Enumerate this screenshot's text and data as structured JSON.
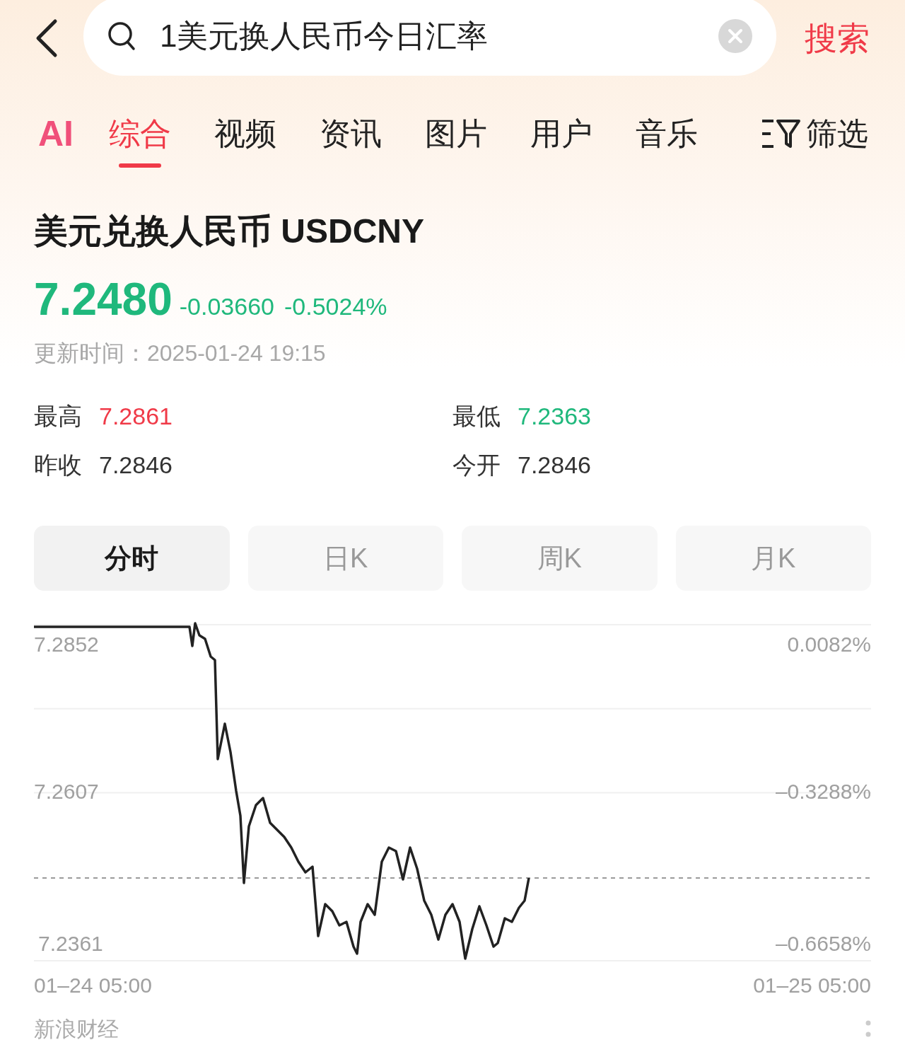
{
  "search_bar": {
    "value": "1美元换人民币今日汇率",
    "submit": "搜索"
  },
  "tabs": [
    {
      "label": "AI",
      "kind": "logo",
      "selected": false
    },
    {
      "label": "综合",
      "kind": "text",
      "selected": true
    },
    {
      "label": "视频",
      "kind": "text",
      "selected": false
    },
    {
      "label": "资讯",
      "kind": "text",
      "selected": false
    },
    {
      "label": "图片",
      "kind": "text",
      "selected": false
    },
    {
      "label": "用户",
      "kind": "text",
      "selected": false
    },
    {
      "label": "音乐",
      "kind": "text",
      "selected": false
    }
  ],
  "filter": "筛选",
  "quote": {
    "title": "美元兑换人民币 USDCNY",
    "price": "7.2480",
    "change": "-0.03660",
    "change_percent": "-0.5024%",
    "color": "#1fb87c",
    "updated": "更新时间：2025-01-24 19:15"
  },
  "stats": [
    {
      "label": "最高",
      "value": "7.2861",
      "color": "#f03a48"
    },
    {
      "label": "最低",
      "value": "7.2363",
      "color": "#1fb87c"
    },
    {
      "label": "昨收",
      "value": "7.2846",
      "color": "#333333"
    },
    {
      "label": "今开",
      "value": "7.2846",
      "color": "#333333"
    }
  ],
  "periods": [
    {
      "label": "分时",
      "selected": true
    },
    {
      "label": "日K",
      "selected": false
    },
    {
      "label": "周K",
      "selected": false
    },
    {
      "label": "月K",
      "selected": false
    }
  ],
  "chart": {
    "right_axis_labels": [
      "0.0082%",
      "–0.3288%",
      "–0.6658%"
    ],
    "time_axis_labels": [
      "01–24 05:00",
      "01–25 05:00"
    ],
    "price_axis_labels": [
      "7.2852",
      "7.2607",
      "7.2361"
    ]
  },
  "source": "新浪财经"
}
